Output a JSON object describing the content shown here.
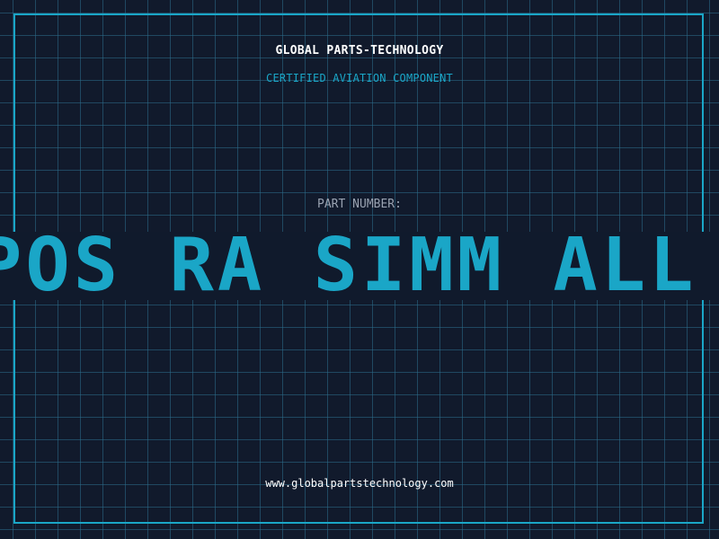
{
  "header": {
    "company_name": "GLOBAL PARTS-TECHNOLOGY",
    "tagline": "CERTIFIED AVIATION COMPONENT"
  },
  "part": {
    "label": "PART NUMBER:",
    "value": "POS RA SIMM ALL PLA"
  },
  "footer": {
    "website": "www.globalpartstechnology.com"
  },
  "colors": {
    "background": "#111a2c",
    "grid": "#2c6e8c",
    "accent": "#1aa6c7",
    "text_primary": "#ffffff",
    "text_muted": "#9aa3b2"
  }
}
